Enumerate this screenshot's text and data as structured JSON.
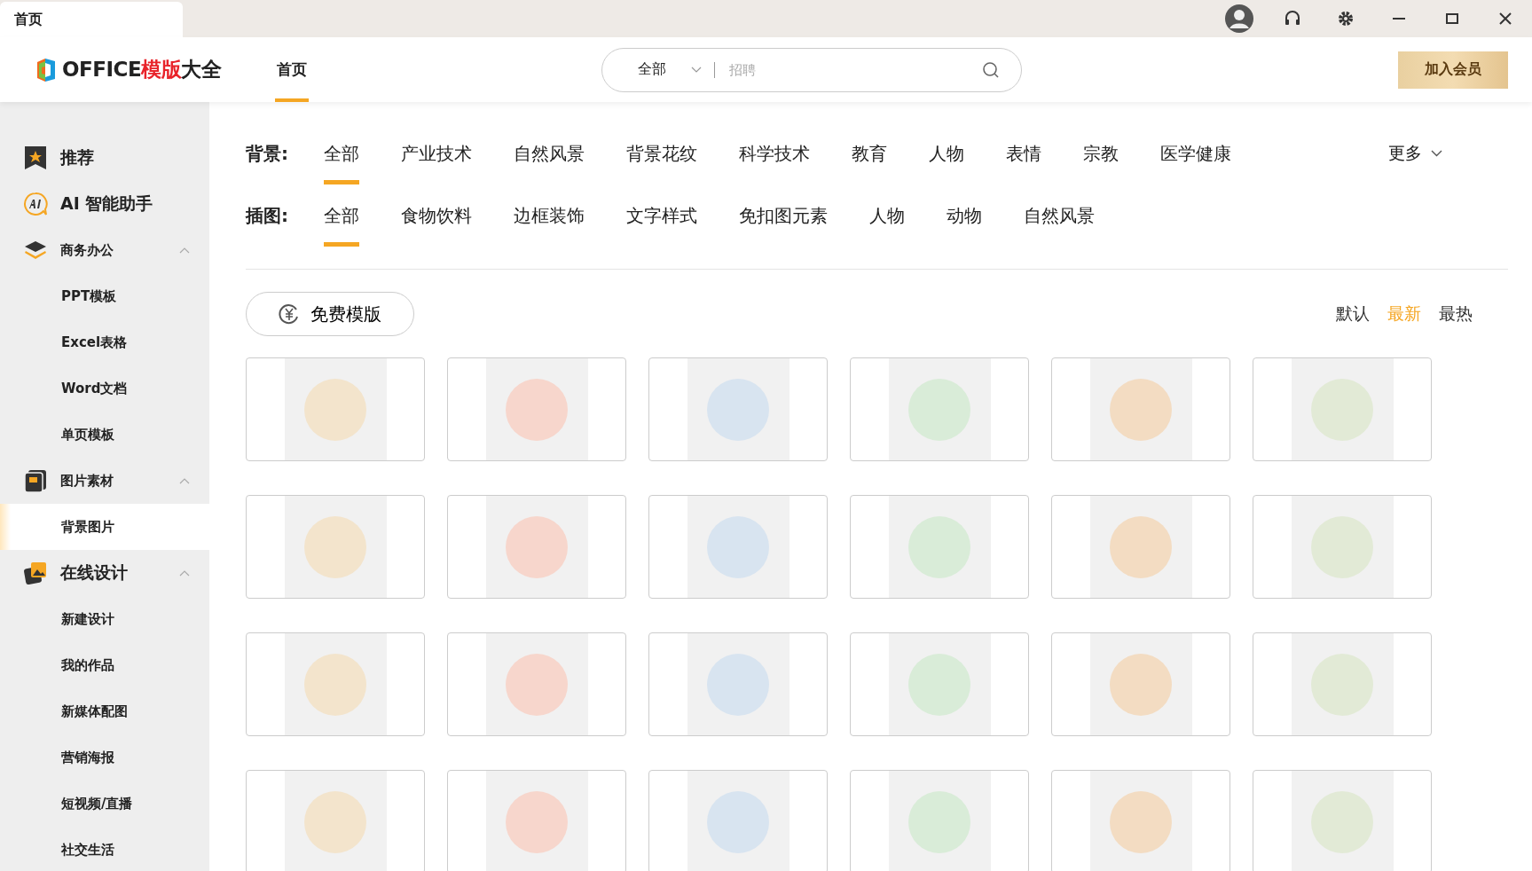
{
  "window_tab": {
    "label": "首页",
    "selected": true
  },
  "header": {
    "logo": {
      "text": "OFFICE",
      "accent": "模版",
      "suffix": "大全"
    },
    "nav": [
      {
        "label": "首页",
        "selected": true
      }
    ],
    "search": {
      "category": "全部",
      "placeholder": "招聘"
    },
    "member_button": "加入会员"
  },
  "sidebar": [
    {
      "label": "推荐",
      "prominent": true,
      "selected": false
    },
    {
      "label": "AI 智能助手",
      "prominent": true,
      "selected": false
    },
    {
      "label": "商务办公",
      "prominent": false,
      "selected": false,
      "expanded": true,
      "children": [
        {
          "label": "PPT模板",
          "selected": false
        },
        {
          "label": "Excel表格",
          "selected": false
        },
        {
          "label": "Word文档",
          "selected": false
        },
        {
          "label": "单页模板",
          "selected": false
        }
      ]
    },
    {
      "label": "图片素材",
      "prominent": false,
      "selected": false,
      "expanded": true,
      "children": [
        {
          "label": "背景图片",
          "selected": true
        }
      ]
    },
    {
      "label": "在线设计",
      "prominent": true,
      "selected": false,
      "expanded": true,
      "children": [
        {
          "label": "新建设计",
          "selected": false
        },
        {
          "label": "我的作品",
          "selected": false
        },
        {
          "label": "新媒体配图",
          "selected": false
        },
        {
          "label": "营销海报",
          "selected": false
        },
        {
          "label": "短视频/直播",
          "selected": false
        },
        {
          "label": "社交生活",
          "selected": false
        }
      ]
    }
  ],
  "filters": [
    {
      "label": "背景:",
      "options": [
        {
          "label": "全部",
          "selected": true
        },
        {
          "label": "产业技术",
          "selected": false
        },
        {
          "label": "自然风景",
          "selected": false
        },
        {
          "label": "背景花纹",
          "selected": false
        },
        {
          "label": "科学技术",
          "selected": false
        },
        {
          "label": "教育",
          "selected": false
        },
        {
          "label": "人物",
          "selected": false
        },
        {
          "label": "表情",
          "selected": false
        },
        {
          "label": "宗教",
          "selected": false
        },
        {
          "label": "医学健康",
          "selected": false
        }
      ],
      "more": "更多"
    },
    {
      "label": "插图:",
      "options": [
        {
          "label": "全部",
          "selected": true
        },
        {
          "label": "食物饮料",
          "selected": false
        },
        {
          "label": "边框装饰",
          "selected": false
        },
        {
          "label": "文字样式",
          "selected": false
        },
        {
          "label": "免扣图元素",
          "selected": false
        },
        {
          "label": "人物",
          "selected": false
        },
        {
          "label": "动物",
          "selected": false
        },
        {
          "label": "自然风景",
          "selected": false
        }
      ]
    }
  ],
  "free_button": "免费模版",
  "sort": [
    {
      "label": "默认",
      "selected": false
    },
    {
      "label": "最新",
      "selected": true
    },
    {
      "label": "最热",
      "selected": false
    }
  ],
  "templates": [
    {
      "kind": "image"
    },
    {
      "kind": "image"
    },
    {
      "kind": "image"
    },
    {
      "kind": "image"
    },
    {
      "kind": "image"
    },
    {
      "kind": "image"
    },
    {
      "kind": "image"
    },
    {
      "kind": "image"
    },
    {
      "kind": "image"
    },
    {
      "kind": "image"
    },
    {
      "kind": "image"
    },
    {
      "kind": "image"
    },
    {
      "kind": "image"
    },
    {
      "kind": "image"
    },
    {
      "kind": "image"
    },
    {
      "kind": "image"
    },
    {
      "kind": "image"
    },
    {
      "kind": "image"
    },
    {
      "kind": "image"
    },
    {
      "kind": "image"
    },
    {
      "kind": "image"
    },
    {
      "kind": "image"
    },
    {
      "kind": "image"
    },
    {
      "kind": "image"
    }
  ]
}
